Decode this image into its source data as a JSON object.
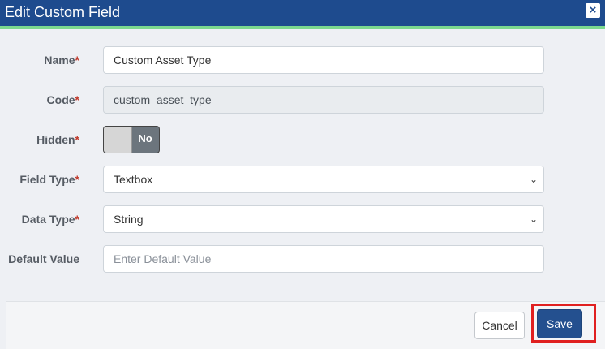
{
  "dialog": {
    "title": "Edit Custom Field",
    "close_label": "×"
  },
  "form": {
    "required_marker": "*",
    "name": {
      "label": "Name",
      "value": "Custom Asset Type"
    },
    "code": {
      "label": "Code",
      "value": "custom_asset_type"
    },
    "hidden": {
      "label": "Hidden",
      "value": "No"
    },
    "field_type": {
      "label": "Field Type",
      "value": "Textbox"
    },
    "data_type": {
      "label": "Data Type",
      "value": "String"
    },
    "default_value": {
      "label": "Default Value",
      "placeholder": "Enter Default Value"
    }
  },
  "footer": {
    "cancel_label": "Cancel",
    "save_label": "Save"
  },
  "colors": {
    "header_bg": "#1e4b8e",
    "header_accent": "#7cd98f",
    "primary_button": "#24508f",
    "highlight_border": "#e02020",
    "required_marker": "#c0392b"
  }
}
